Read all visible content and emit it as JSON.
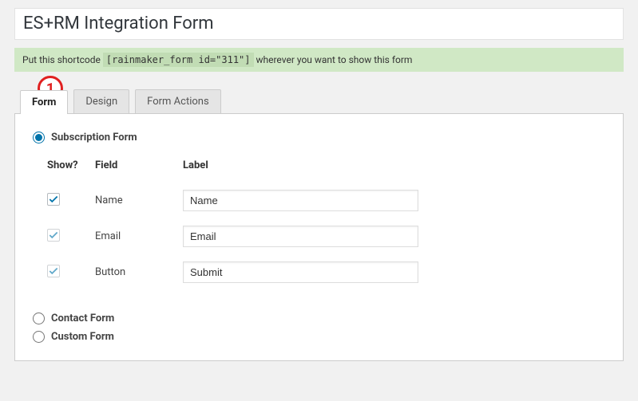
{
  "title": "ES+RM Integration Form",
  "notice": {
    "prefix": "Put this shortcode  ",
    "code": "[rainmaker_form id=\"311\"]",
    "suffix": "  wherever you want to show this form"
  },
  "annotation": {
    "number": "1"
  },
  "tabs": {
    "form": "Form",
    "design": "Design",
    "actions": "Form Actions",
    "active": "form"
  },
  "form": {
    "options": {
      "subscription": "Subscription Form",
      "contact": "Contact Form",
      "custom": "Custom Form"
    },
    "selected": "subscription",
    "headers": {
      "show": "Show?",
      "field": "Field",
      "label": "Label"
    },
    "fields": [
      {
        "field": "Name",
        "label": "Name",
        "checked": true,
        "locked": false
      },
      {
        "field": "Email",
        "label": "Email",
        "checked": true,
        "locked": true
      },
      {
        "field": "Button",
        "label": "Submit",
        "checked": true,
        "locked": true
      }
    ]
  },
  "colors": {
    "accent": "#0073aa"
  }
}
